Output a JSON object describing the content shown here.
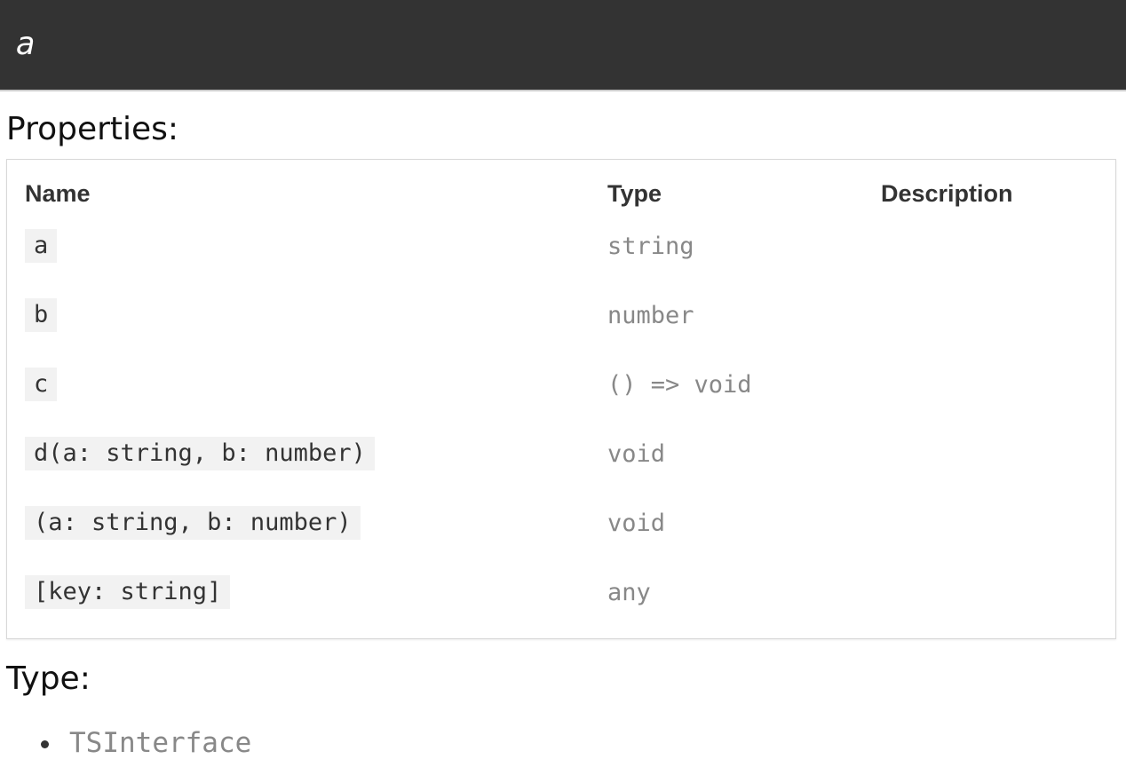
{
  "header": {
    "title": "a"
  },
  "properties": {
    "heading": "Properties:",
    "columns": {
      "name": "Name",
      "type": "Type",
      "description": "Description"
    },
    "rows": [
      {
        "name": "a",
        "type": "string",
        "description": ""
      },
      {
        "name": "b",
        "type": "number",
        "description": ""
      },
      {
        "name": "c",
        "type": "() => void",
        "description": ""
      },
      {
        "name": "d(a: string, b: number)",
        "type": "void",
        "description": ""
      },
      {
        "name": "(a: string, b: number)",
        "type": "void",
        "description": ""
      },
      {
        "name": "[key: string]",
        "type": "any",
        "description": ""
      }
    ]
  },
  "type_section": {
    "heading": "Type:",
    "items": [
      "TSInterface"
    ]
  }
}
